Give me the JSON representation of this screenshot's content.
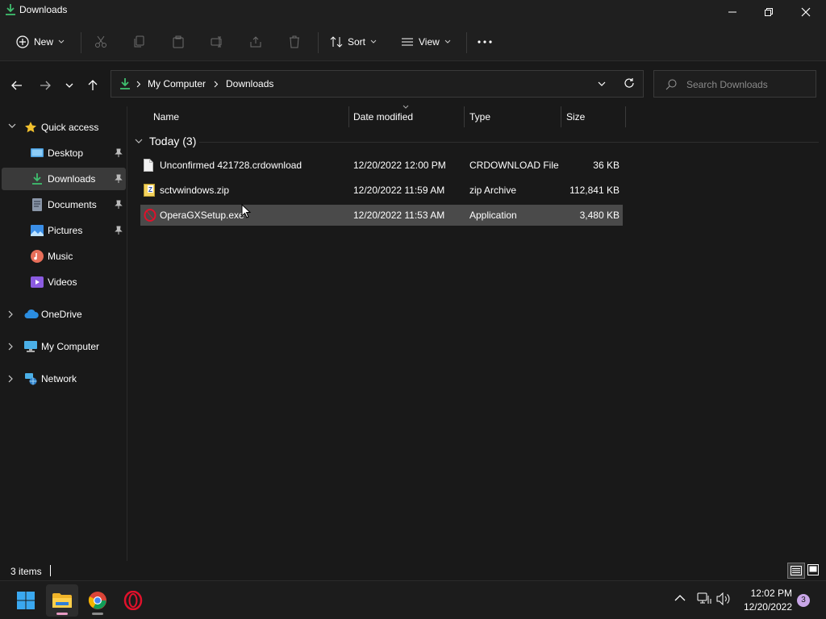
{
  "window": {
    "title": "Downloads"
  },
  "toolbar": {
    "new_label": "New",
    "sort_label": "Sort",
    "view_label": "View"
  },
  "address": {
    "crumbs": [
      "My Computer",
      "Downloads"
    ]
  },
  "search": {
    "placeholder": "Search Downloads"
  },
  "sidebar": {
    "quick_access": "Quick access",
    "items": [
      {
        "label": "Desktop",
        "icon": "desktop-icon",
        "pinned": true
      },
      {
        "label": "Downloads",
        "icon": "download-icon",
        "pinned": true,
        "selected": true
      },
      {
        "label": "Documents",
        "icon": "documents-icon",
        "pinned": true
      },
      {
        "label": "Pictures",
        "icon": "pictures-icon",
        "pinned": true
      },
      {
        "label": "Music",
        "icon": "music-icon",
        "pinned": false
      },
      {
        "label": "Videos",
        "icon": "videos-icon",
        "pinned": false
      }
    ],
    "roots": [
      {
        "label": "OneDrive",
        "icon": "onedrive-icon"
      },
      {
        "label": "My Computer",
        "icon": "computer-icon"
      },
      {
        "label": "Network",
        "icon": "network-icon"
      }
    ]
  },
  "columns": {
    "name": "Name",
    "date": "Date modified",
    "type": "Type",
    "size": "Size"
  },
  "group": {
    "label": "Today (3)"
  },
  "files": [
    {
      "name": "Unconfirmed 421728.crdownload",
      "date": "12/20/2022 12:00 PM",
      "type": "CRDOWNLOAD File",
      "size": "36 KB",
      "icon": "file-icon"
    },
    {
      "name": "sctvwindows.zip",
      "date": "12/20/2022 11:59 AM",
      "type": "zip Archive",
      "size": "112,841 KB",
      "icon": "zip-icon"
    },
    {
      "name": "OperaGXSetup.exe",
      "date": "12/20/2022 11:53 AM",
      "type": "Application",
      "size": "3,480 KB",
      "icon": "opera-gx-icon",
      "selected": true
    }
  ],
  "status": {
    "item_count": "3 items"
  },
  "taskbar": {
    "time": "12:02 PM",
    "date": "12/20/2022",
    "notification_count": "3"
  },
  "colors": {
    "accent_green": "#3fbf6f",
    "selection": "#4a4a4a",
    "opera_red": "#e0112b"
  }
}
